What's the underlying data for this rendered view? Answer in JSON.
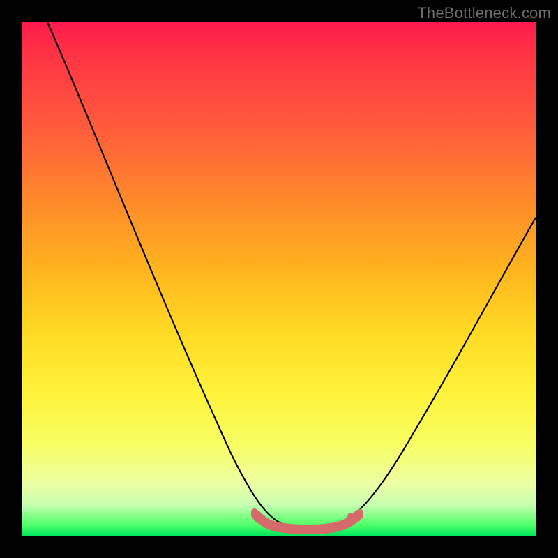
{
  "attribution": "TheBottleneck.com",
  "chart_data": {
    "type": "line",
    "title": "",
    "xlabel": "",
    "ylabel": "",
    "xlim": [
      0,
      100
    ],
    "ylim": [
      0,
      100
    ],
    "series": [
      {
        "name": "bottleneck-curve",
        "x": [
          5,
          10,
          15,
          20,
          25,
          30,
          35,
          40,
          45,
          48,
          50,
          52,
          54,
          56,
          58,
          60,
          65,
          70,
          75,
          80,
          85,
          90,
          95,
          100
        ],
        "y": [
          100,
          89,
          78,
          67,
          56,
          45,
          34,
          24,
          14,
          8,
          4,
          2,
          1,
          1,
          1,
          2,
          6,
          12,
          20,
          29,
          38,
          47,
          55,
          62
        ]
      },
      {
        "name": "tolerance-band",
        "x": [
          48,
          50,
          52,
          54,
          56,
          58,
          60,
          62
        ],
        "y": [
          4,
          2,
          1,
          1,
          1,
          1,
          2,
          4
        ]
      }
    ],
    "colors": {
      "curve": "#000000",
      "band": "#d46a6a",
      "gradient_top": "#ff1a4d",
      "gradient_bottom": "#00e65e"
    }
  }
}
